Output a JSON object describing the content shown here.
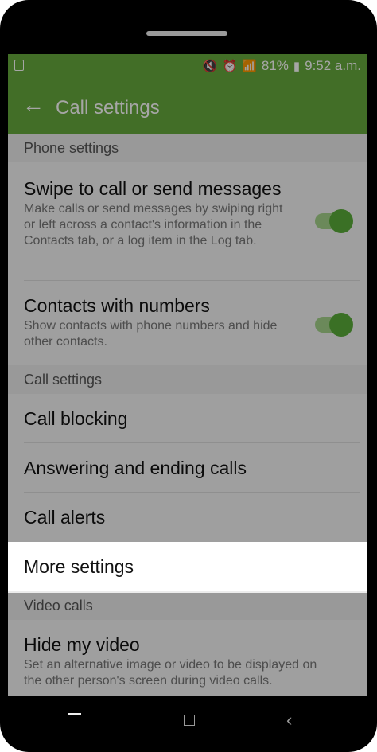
{
  "status": {
    "battery": "81%",
    "time": "9:52 a.m.",
    "icons": [
      "mute-icon",
      "alarm-icon",
      "wifi-icon",
      "signal-icon",
      "battery-icon"
    ]
  },
  "appbar": {
    "title": "Call settings",
    "back_icon": "back-arrow-icon"
  },
  "sections": {
    "phone": "Phone settings",
    "call": "Call settings",
    "video": "Video calls"
  },
  "items": {
    "swipe_title": "Swipe to call or send messages",
    "swipe_desc": "Make calls or send messages by swiping right or left across a contact's information in the Contacts tab, or a log item in the Log tab.",
    "swipe_enabled": true,
    "contacts_title": "Contacts with numbers",
    "contacts_desc": "Show contacts with phone numbers and hide other contacts.",
    "contacts_enabled": true,
    "call_blocking": "Call blocking",
    "answering": "Answering and ending calls",
    "alerts": "Call alerts",
    "more": "More settings",
    "hide_video_title": "Hide my video",
    "hide_video_desc": "Set an alternative image or video to be displayed on the other person's screen during video calls."
  },
  "colors": {
    "accent": "#66aa3c",
    "toggle_on": "#5aad3a"
  }
}
